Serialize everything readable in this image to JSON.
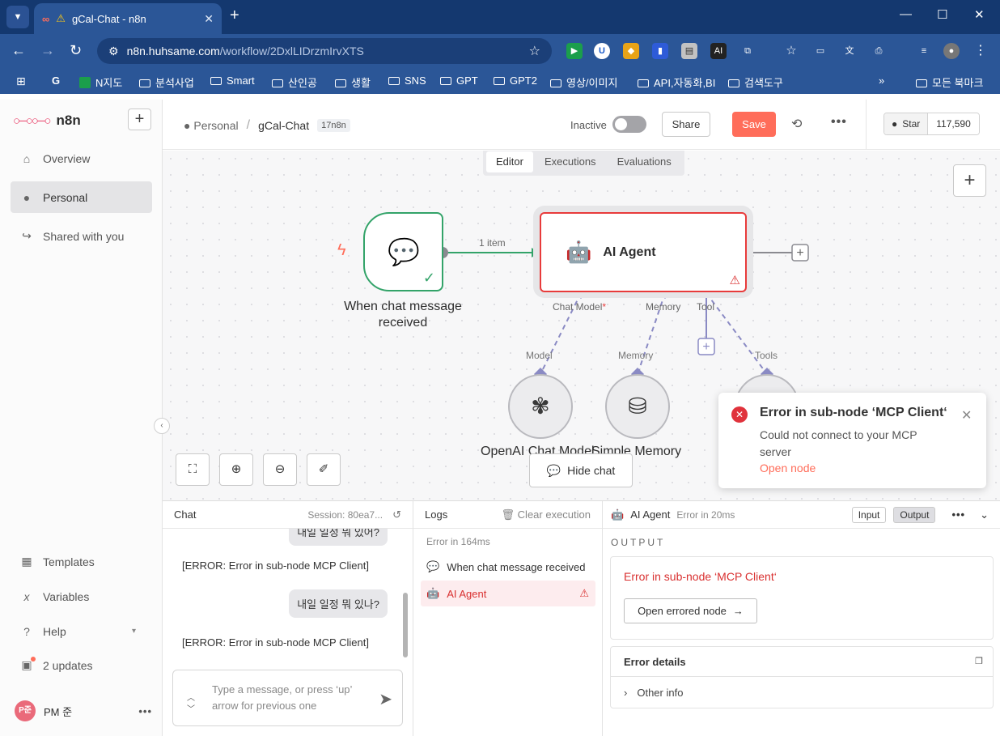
{
  "browser": {
    "tab_title": "gCal-Chat - n8n",
    "url_host": "n8n.huhsame.com",
    "url_path": "/workflow/2DxlLIDrzmIrvXTS",
    "ext_ai_label": "AI",
    "bookmarks": [
      "N지도",
      "분석사업",
      "Smart",
      "산인공",
      "생활",
      "SNS",
      "GPT",
      "GPT2",
      "영상/이미지",
      "API,자동화,BI",
      "검색도구"
    ],
    "bookmarks_all": "모든 북마크"
  },
  "app": {
    "name": "n8n",
    "sidebar": {
      "items": [
        {
          "label": "Overview",
          "icon": "home-icon"
        },
        {
          "label": "Personal",
          "icon": "user-icon"
        },
        {
          "label": "Shared with you",
          "icon": "share-icon"
        }
      ],
      "bottom": [
        {
          "label": "Templates",
          "icon": "templates-icon"
        },
        {
          "label": "Variables",
          "icon": "variables-icon"
        },
        {
          "label": "Help",
          "icon": "help-icon"
        },
        {
          "label": "2 updates",
          "icon": "gift-icon"
        }
      ],
      "user": {
        "initials": "P준",
        "name": "PM 준"
      }
    }
  },
  "header": {
    "project": "Personal",
    "workflow": "gCal-Chat",
    "tag": "17n8n",
    "status": "Inactive",
    "share": "Share",
    "save": "Save",
    "github_star": "Star",
    "github_count": "117,590"
  },
  "canvas": {
    "tabs": [
      "Editor",
      "Executions",
      "Evaluations"
    ],
    "active_tab": "Editor",
    "edge_label": "1 item",
    "nodes": {
      "trigger": "When chat message received",
      "agent": "AI Agent",
      "openai": "OpenAI Chat Model",
      "memory": "Simple Memory"
    },
    "ports": {
      "chat_model": "Chat Model",
      "required_mark": "*",
      "memory": "Memory",
      "tool": "Tool",
      "model_sub": "Model",
      "memory_sub": "Memory",
      "tools_sub": "Tools"
    },
    "hide_chat": "Hide chat"
  },
  "toast": {
    "title": "Error in sub-node ‘MCP Client‘",
    "message": "Could not connect to your MCP server",
    "link": "Open node"
  },
  "chat": {
    "title": "Chat",
    "session": "Session: 80ea7...",
    "messages": [
      {
        "role": "user",
        "text": "내일 일정 뭐 있어?"
      },
      {
        "role": "bot",
        "text": "[ERROR: Error in sub-node MCP Client]"
      },
      {
        "role": "user",
        "text": "내일 일정 뭐 있나?"
      },
      {
        "role": "bot",
        "text": "[ERROR: Error in sub-node MCP Client]"
      }
    ],
    "placeholder": "Type a message, or press ‘up’ arrow for previous one"
  },
  "logs": {
    "title": "Logs",
    "clear": "Clear execution",
    "status": "Error in 164ms",
    "rows": [
      {
        "label": "When chat message received"
      },
      {
        "label": "AI Agent"
      }
    ]
  },
  "output": {
    "node": "AI Agent",
    "status": "Error in 20ms",
    "input_tab": "Input",
    "output_tab": "Output",
    "section": "OUTPUT",
    "error": "Error in sub-node ‘MCP Client‘",
    "open_errored": "Open errored node",
    "details_title": "Error details",
    "other_info": "Other info"
  },
  "colors": {
    "accent": "#ff6d5a",
    "success": "#33a369",
    "error": "#e83b3b",
    "browser_chrome": "#2b5697"
  }
}
